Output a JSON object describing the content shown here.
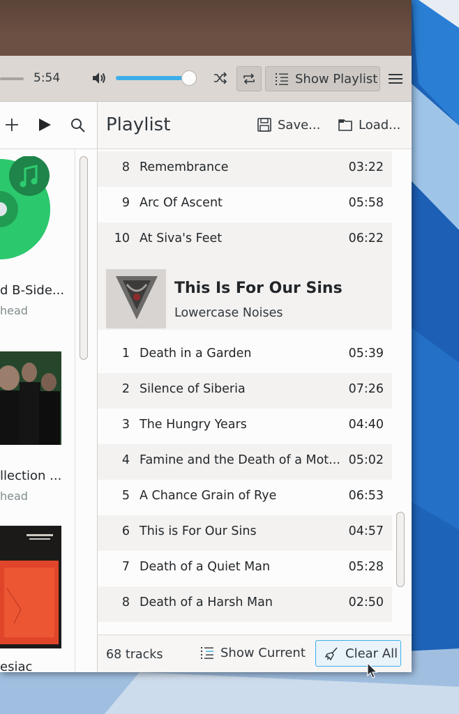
{
  "theme": {
    "accent": "#3daee9",
    "toolbar_bg": "#dcd7d2",
    "alt_row_bg": "#f3f2f1",
    "album_green": "#2ecc71"
  },
  "toolbar": {
    "time_total": "5:54",
    "volume_level": 0.88,
    "show_playlist_label": "Show Playlist"
  },
  "library": {
    "albums": [
      {
        "title": "d B-Side...",
        "artist": "head",
        "cover": "music-note-green"
      },
      {
        "title": "llection ...",
        "artist": "head",
        "cover": "band-photo"
      },
      {
        "title": "esiac",
        "artist": "",
        "cover": "red-artwork"
      }
    ]
  },
  "playlist": {
    "title": "Playlist",
    "save_label": "Save...",
    "load_label": "Load...",
    "tracks_before": [
      {
        "num": "8",
        "title": "Remembrance",
        "duration": "03:22"
      },
      {
        "num": "9",
        "title": "Arc Of Ascent",
        "duration": "05:58"
      },
      {
        "num": "10",
        "title": "At Siva's Feet",
        "duration": "06:22"
      }
    ],
    "album": {
      "title": "This Is For Our Sins",
      "artist": "Lowercase Noises"
    },
    "tracks": [
      {
        "num": "1",
        "title": "Death in a Garden",
        "duration": "05:39"
      },
      {
        "num": "2",
        "title": "Silence of Siberia",
        "duration": "07:26"
      },
      {
        "num": "3",
        "title": "The Hungry Years",
        "duration": "04:40"
      },
      {
        "num": "4",
        "title": "Famine and the Death of a Mot...",
        "duration": "05:02"
      },
      {
        "num": "5",
        "title": "A Chance Grain of Rye",
        "duration": "06:53"
      },
      {
        "num": "6",
        "title": "This is For Our Sins",
        "duration": "04:57"
      },
      {
        "num": "7",
        "title": "Death of a Quiet Man",
        "duration": "05:28"
      },
      {
        "num": "8",
        "title": "Death of a Harsh Man",
        "duration": "02:50"
      }
    ],
    "track_count": "68 tracks",
    "show_current_label": "Show Current",
    "clear_all_label": "Clear All"
  }
}
